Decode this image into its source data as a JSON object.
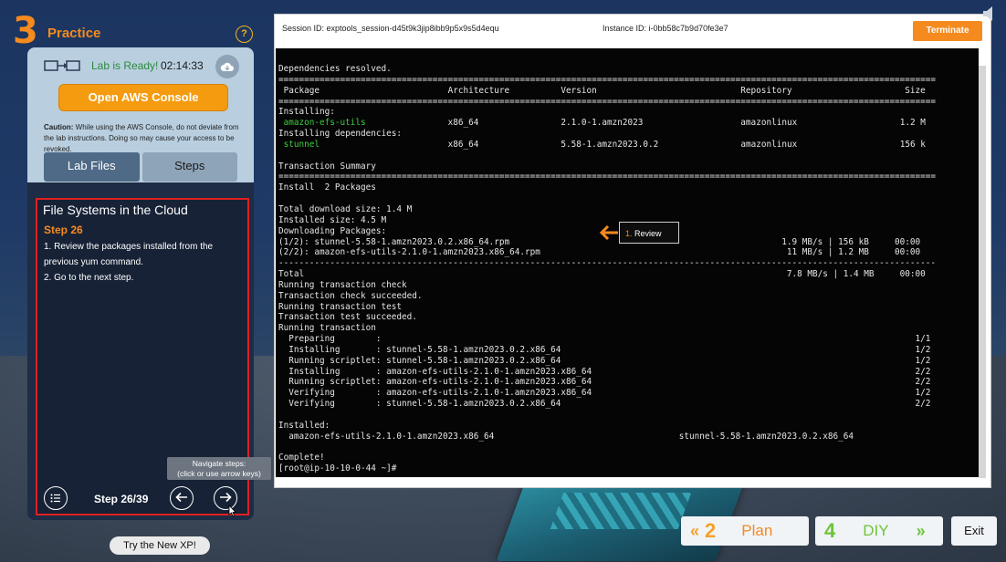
{
  "header": {
    "section_number": "3",
    "section_name": "Practice",
    "help_label": "?"
  },
  "lab": {
    "status": "Lab is Ready!",
    "timer": "02:14:33",
    "open_console_label": "Open AWS Console",
    "caution_prefix": "Caution:",
    "caution_text": "While using the AWS Console, do not deviate from the lab instructions. Doing so may cause your access to be revoked."
  },
  "tabs": [
    {
      "label": "Lab Files"
    },
    {
      "label": "Steps"
    }
  ],
  "steps": {
    "section_title": "File Systems in the Cloud",
    "step_label": "Step 26",
    "items": [
      "1. Review the packages installed from the previous yum command.",
      "2. Go to the next step."
    ],
    "counter": "Step 26/39",
    "tooltip_line1": "Navigate steps:",
    "tooltip_line2": "(click or use arrow keys)"
  },
  "try_new_label": "Try the New XP!",
  "session": {
    "session_id": "Session ID: exptools_session-d45t9k3jip8ibb9p5x9s5d4equ",
    "instance_id": "Instance ID: i-0bb58c7b9d70fe3e7",
    "terminate_label": "Terminate"
  },
  "terminal": {
    "lines": [
      "Dependencies resolved.",
      "================================================================================================================================",
      " Package                         Architecture          Version                            Repository                      Size",
      "================================================================================================================================",
      "Installing:",
      " amazon-efs-utils                x86_64                2.1.0-1.amzn2023                   amazonlinux                    1.2 M",
      "Installing dependencies:",
      " stunnel                         x86_64                5.58-1.amzn2023.0.2                amazonlinux                    156 k",
      "",
      "Transaction Summary",
      "================================================================================================================================",
      "Install  2 Packages",
      "",
      "Total download size: 1.4 M",
      "Installed size: 4.5 M",
      "Downloading Packages:",
      "(1/2): stunnel-5.58-1.amzn2023.0.2.x86_64.rpm                                                     1.9 MB/s | 156 kB     00:00",
      "(2/2): amazon-efs-utils-2.1.0-1.amzn2023.x86_64.rpm                                                11 MB/s | 1.2 MB     00:00",
      "--------------------------------------------------------------------------------------------------------------------------------",
      "Total                                                                                              7.8 MB/s | 1.4 MB     00:00",
      "Running transaction check",
      "Transaction check succeeded.",
      "Running transaction test",
      "Transaction test succeeded.",
      "Running transaction",
      "  Preparing        :                                                                                                        1/1",
      "  Installing       : stunnel-5.58-1.amzn2023.0.2.x86_64                                                                     1/2",
      "  Running scriptlet: stunnel-5.58-1.amzn2023.0.2.x86_64                                                                     1/2",
      "  Installing       : amazon-efs-utils-2.1.0-1.amzn2023.x86_64                                                               2/2",
      "  Running scriptlet: amazon-efs-utils-2.1.0-1.amzn2023.x86_64                                                               2/2",
      "  Verifying        : amazon-efs-utils-2.1.0-1.amzn2023.x86_64                                                               1/2",
      "  Verifying        : stunnel-5.58-1.amzn2023.0.2.x86_64                                                                     2/2",
      "",
      "Installed:",
      "  amazon-efs-utils-2.1.0-1.amzn2023.x86_64                                    stunnel-5.58-1.amzn2023.0.2.x86_64",
      "",
      "Complete!",
      "[root@ip-10-10-0-44 ~]#"
    ],
    "callout_number": "1.",
    "callout_text": "Review"
  },
  "bottom_nav": {
    "plan_number": "2",
    "plan_label": "Plan",
    "diy_number": "4",
    "diy_label": "DIY",
    "exit_label": "Exit"
  },
  "colors": {
    "accent": "#f58a1f",
    "ready": "#2c8a3d",
    "highlight_border": "#e02020",
    "package_green": "#3fcf3f"
  }
}
